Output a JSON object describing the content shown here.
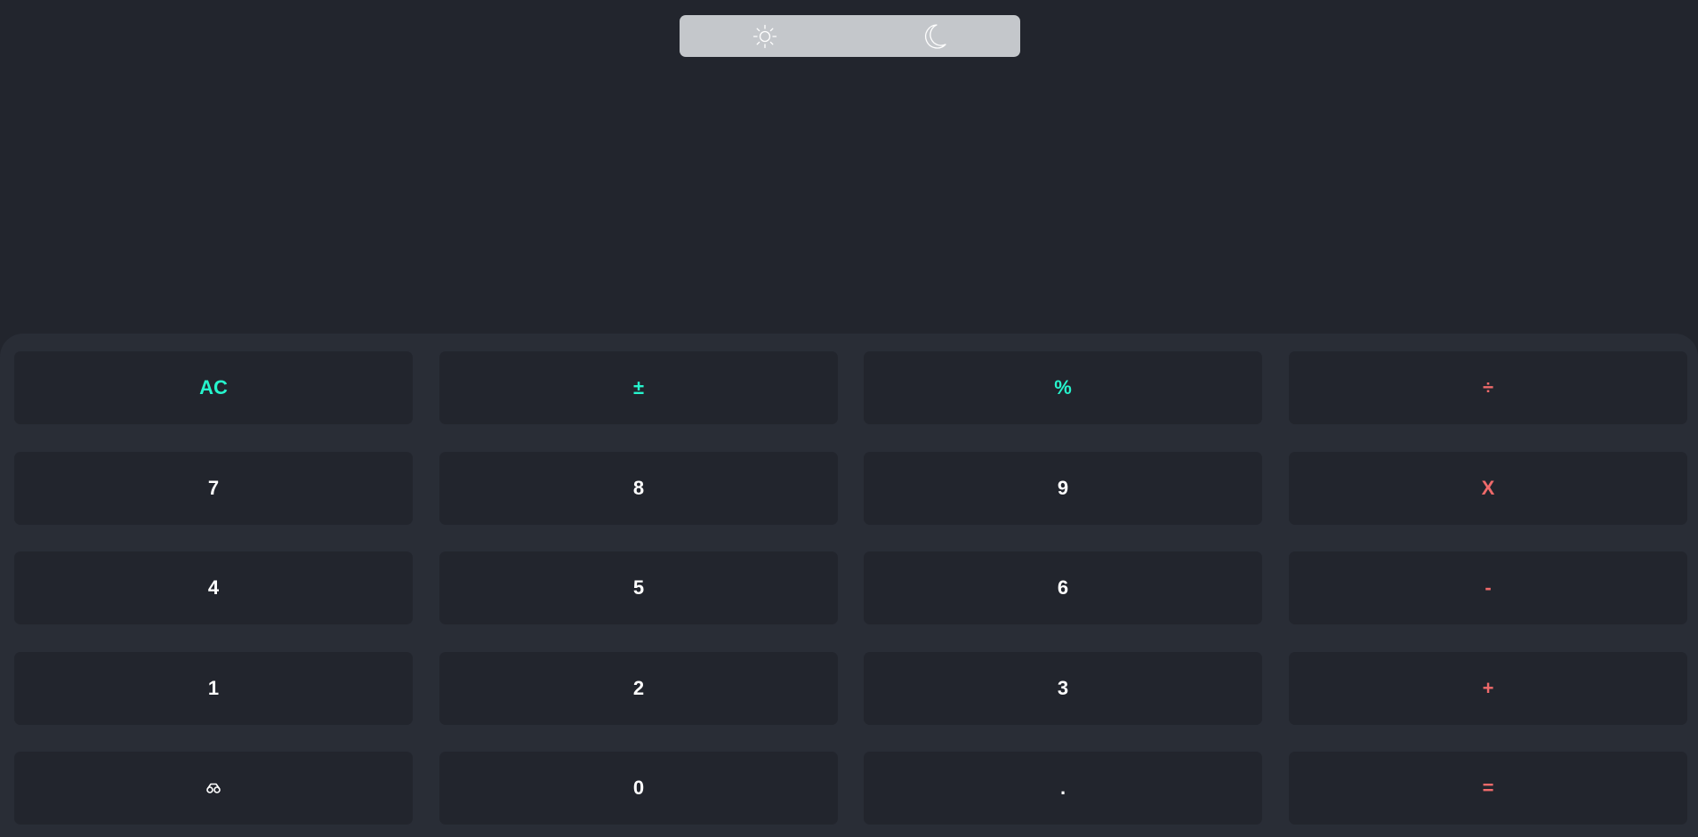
{
  "theme_toggle": {
    "light_icon": "sun-icon",
    "dark_icon": "moon-icon"
  },
  "colors": {
    "background": "#22252d",
    "keypad": "#292d36",
    "key": "#22252d",
    "function_key": "#26f4cc",
    "operator_key": "#ef6a6a",
    "digit_key": "#ffffff",
    "toggle": "#c4c7cb"
  },
  "display": {
    "expression": "",
    "result": ""
  },
  "keys": {
    "ac": "AC",
    "plus_minus": "±",
    "percent": "%",
    "divide": "÷",
    "seven": "7",
    "eight": "8",
    "nine": "9",
    "multiply": "X",
    "four": "4",
    "five": "5",
    "six": "6",
    "minus": "-",
    "one": "1",
    "two": "2",
    "three": "3",
    "plus": "+",
    "history_icon": "history-icon",
    "zero": "0",
    "decimal": ".",
    "equals": "="
  }
}
